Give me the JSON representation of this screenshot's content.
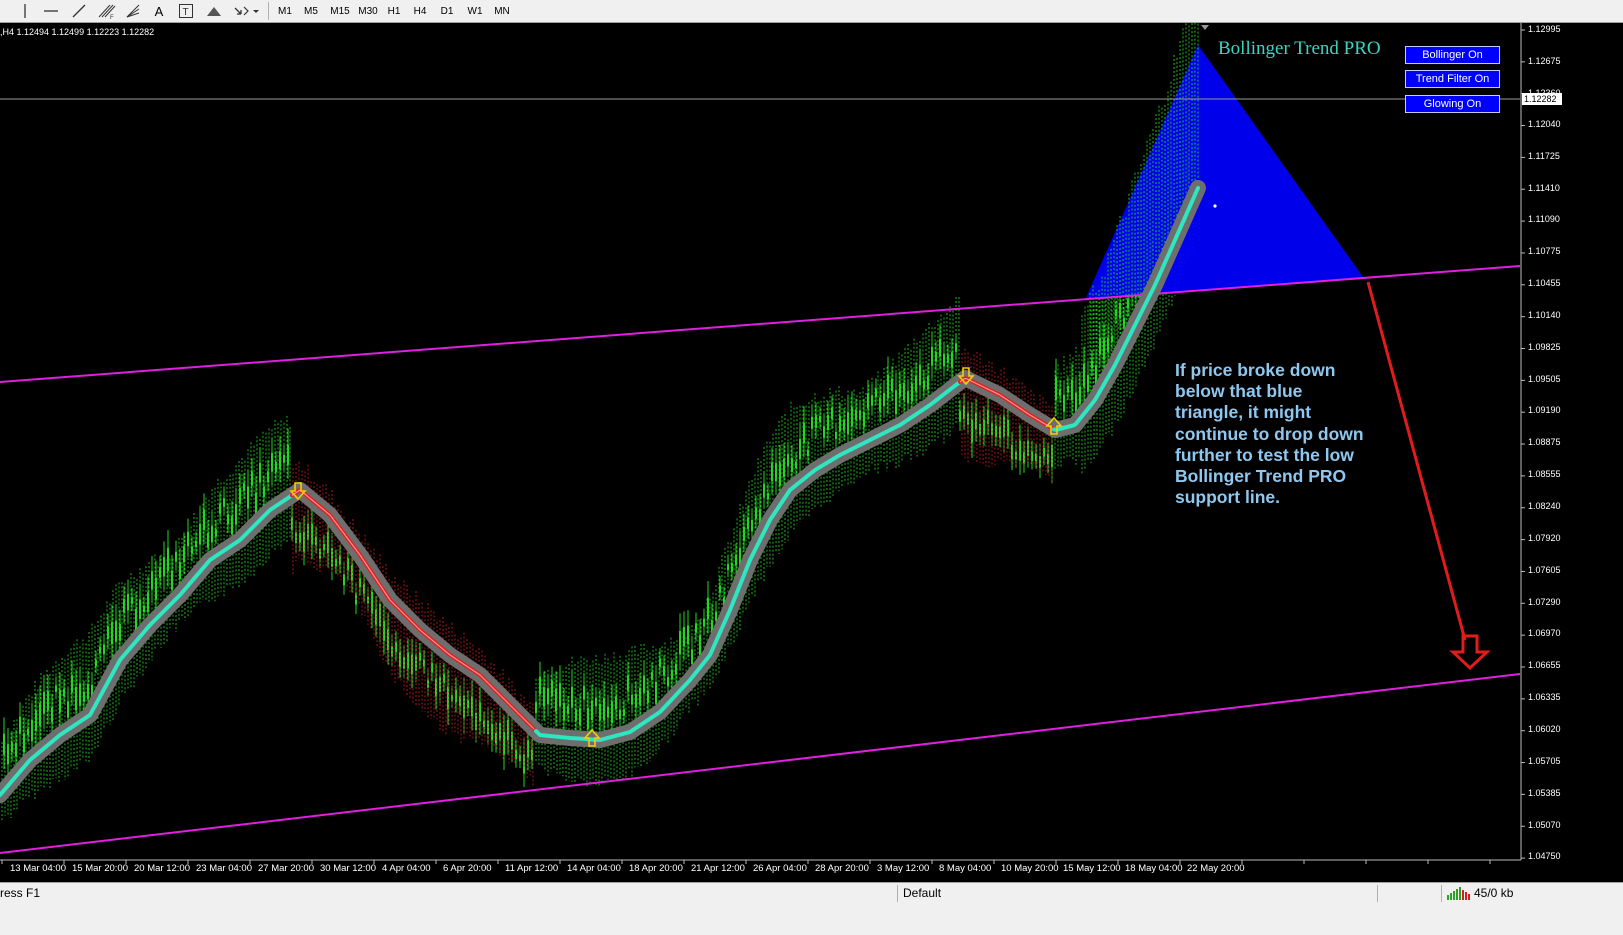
{
  "toolbar": {
    "timeframes": [
      "M1",
      "M5",
      "M15",
      "M30",
      "H1",
      "H4",
      "D1",
      "W1",
      "MN"
    ],
    "text_tool_glyph": "A",
    "textlabel_tool_glyph": "T"
  },
  "chart": {
    "ohlc_info": ",H4  1.12494 1.12499 1.12223 1.12282",
    "current_price": "1.12282",
    "indicator_title": "Bollinger Trend PRO",
    "buttons": [
      "Bollinger On",
      "Trend Filter On",
      "Glowing On"
    ],
    "annotation": "If price broke down below that blue triangle, it might continue to drop down further to test the low Bollinger Trend PRO support line.",
    "price_axis": [
      "1.12995",
      "1.12675",
      "1.12360",
      "1.12040",
      "1.11725",
      "1.11410",
      "1.11090",
      "1.10775",
      "1.10455",
      "1.10140",
      "1.09825",
      "1.09505",
      "1.09190",
      "1.08875",
      "1.08555",
      "1.08240",
      "1.07920",
      "1.07605",
      "1.07290",
      "1.06970",
      "1.06655",
      "1.06335",
      "1.06020",
      "1.05705",
      "1.05385",
      "1.05070",
      "1.04750"
    ],
    "time_axis": [
      "13 Mar 04:00",
      "15 Mar 20:00",
      "20 Mar 12:00",
      "23 Mar 04:00",
      "27 Mar 20:00",
      "30 Mar 12:00",
      "4 Apr 04:00",
      "6 Apr 20:00",
      "11 Apr 12:00",
      "14 Apr 04:00",
      "18 Apr 20:00",
      "21 Apr 12:00",
      "26 Apr 04:00",
      "28 Apr 20:00",
      "3 May 12:00",
      "8 May 04:00",
      "10 May 20:00",
      "15 May 12:00",
      "18 May 04:00",
      "22 May 20:00"
    ],
    "colors": {
      "bull": "#22d622",
      "bear": "#c81e1e",
      "trend_up": "#2ee6c0",
      "trend_down": "#e02020",
      "channel": "#e020e0",
      "triangle": "#0000ff",
      "arrow": "#e01c1c"
    }
  },
  "status": {
    "help": "ress F1",
    "profile": "Default",
    "traffic": "45/0 kb"
  }
}
